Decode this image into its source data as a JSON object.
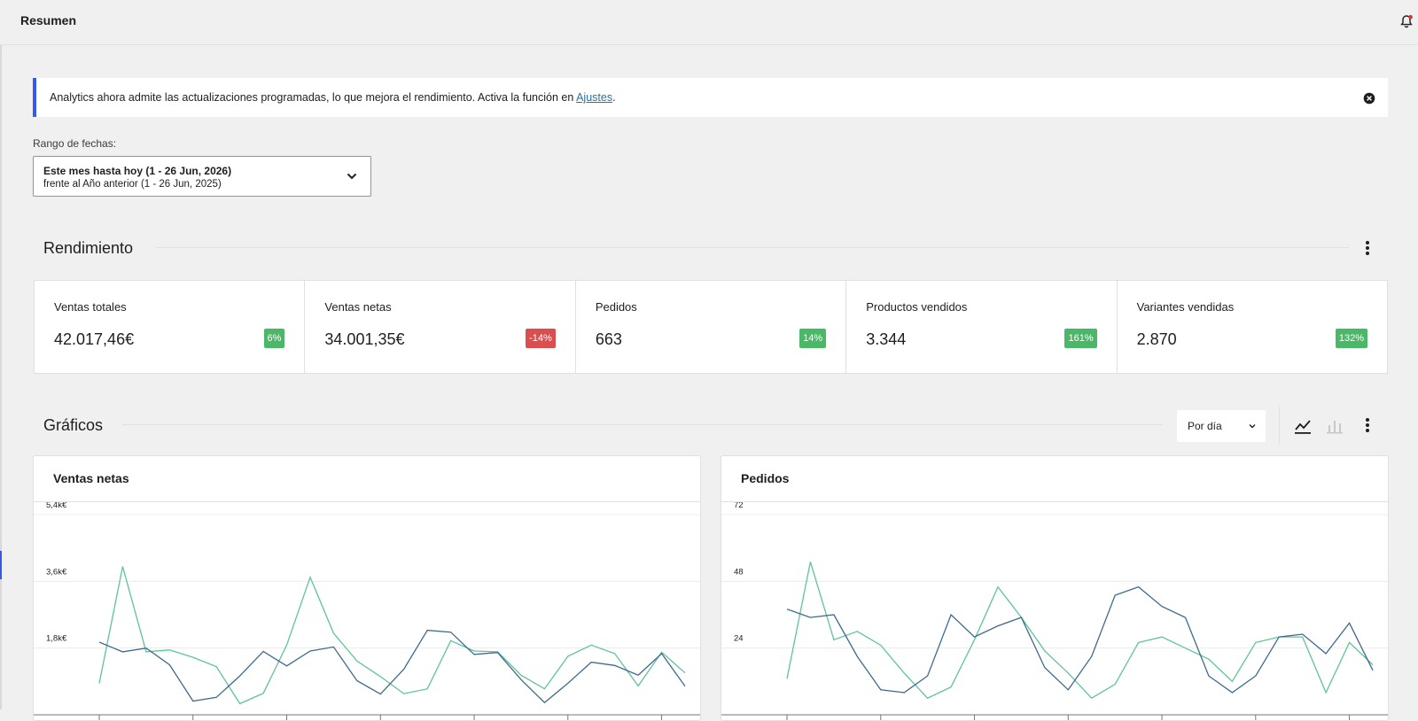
{
  "header": {
    "title": "Resumen",
    "notification_icon": "bell-icon"
  },
  "notice": {
    "text": "Analytics ahora admite las actualizaciones programadas, lo que mejora el rendimiento. Activa la función en ",
    "link": "Ajustes",
    "suffix": "."
  },
  "date_range": {
    "label": "Rango de fechas:",
    "primary": "Este mes hasta hoy (1 - 26 Jun, 2026)",
    "secondary": "frente al Año anterior (1 - 26 Jun, 2025)"
  },
  "performance": {
    "title": "Rendimiento",
    "metrics": [
      {
        "label": "Ventas totales",
        "value": "42.017,46€",
        "delta": "6%",
        "trend": "up"
      },
      {
        "label": "Ventas netas",
        "value": "34.001,35€",
        "delta": "-14%",
        "trend": "down"
      },
      {
        "label": "Pedidos",
        "value": "663",
        "delta": "14%",
        "trend": "up"
      },
      {
        "label": "Productos vendidos",
        "value": "3.344",
        "delta": "161%",
        "trend": "up"
      },
      {
        "label": "Variantes vendidas",
        "value": "2.870",
        "delta": "132%",
        "trend": "up"
      }
    ]
  },
  "charts_section": {
    "title": "Gráficos",
    "interval": "Por día",
    "chart_type_options": [
      "line-chart-icon",
      "bar-chart-icon"
    ],
    "selected_chart_type": "line-chart-icon"
  },
  "colors": {
    "accent": "#3858e9",
    "badge_up": "#4ab866",
    "badge_down": "#d94f4f",
    "series_current": "#5ec49a",
    "series_previous": "#3f6a8f"
  },
  "chart_data": [
    {
      "type": "line",
      "title": "Ventas netas",
      "ylim": [
        0,
        5400
      ],
      "yticks": [
        1800,
        3600,
        5400
      ],
      "ytick_labels": [
        "1,8k€",
        "3,6k€",
        "5,4k€"
      ],
      "grid": true,
      "series": [
        {
          "values": [
            850,
            4000,
            1700,
            1750,
            1550,
            1300,
            300,
            580,
            1880,
            3710,
            2200,
            1450,
            1030,
            570,
            700,
            2000,
            1720,
            1700,
            1070,
            700,
            1580,
            1880,
            1650,
            780,
            1690,
            1130
          ]
        },
        {
          "values": [
            1960,
            1700,
            1800,
            1350,
            370,
            470,
            1050,
            1710,
            1320,
            1720,
            1830,
            920,
            560,
            1230,
            2280,
            2230,
            1630,
            1680,
            950,
            330,
            850,
            1420,
            1330,
            1070,
            1650,
            770
          ]
        }
      ]
    },
    {
      "type": "line",
      "title": "Pedidos",
      "ylim": [
        0,
        72
      ],
      "yticks": [
        24,
        48,
        72
      ],
      "ytick_labels": [
        "24",
        "48",
        "72"
      ],
      "grid": true,
      "series": [
        {
          "values": [
            13,
            55,
            27,
            30,
            25,
            15,
            6,
            10,
            27,
            46,
            35,
            23,
            15,
            6,
            11,
            26,
            28,
            24,
            20,
            12,
            26,
            28,
            28,
            8,
            26,
            18
          ]
        },
        {
          "values": [
            38,
            35,
            36,
            21,
            9,
            8,
            14,
            36,
            28,
            32,
            35,
            17,
            9,
            21,
            43,
            46,
            39,
            35,
            14,
            8,
            14,
            28,
            29,
            22,
            33,
            16
          ]
        }
      ]
    }
  ]
}
